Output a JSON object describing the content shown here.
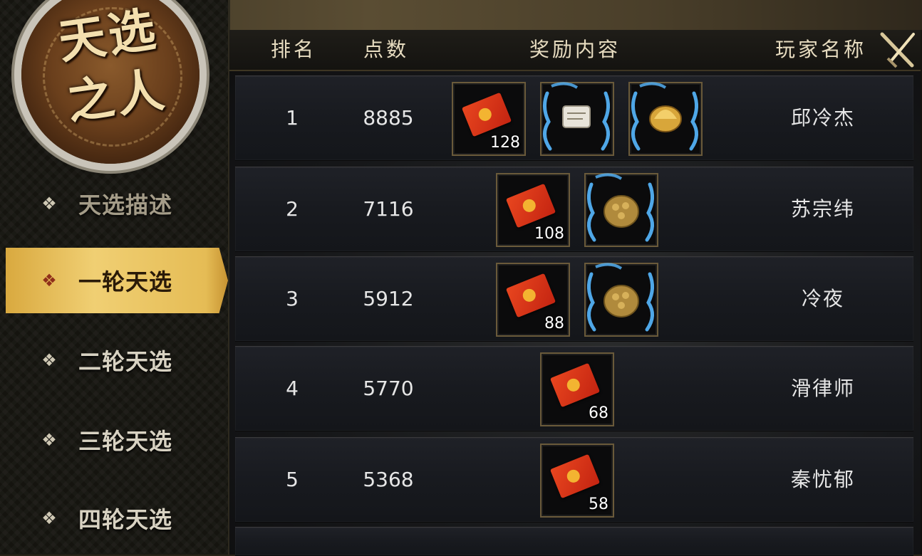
{
  "emblem": {
    "title_line1": "天选",
    "title_line2": "之人"
  },
  "menu": [
    {
      "label": "天选描述",
      "state": "dim"
    },
    {
      "label": "一轮天选",
      "state": "active"
    },
    {
      "label": "二轮天选",
      "state": "normal"
    },
    {
      "label": "三轮天选",
      "state": "normal"
    },
    {
      "label": "四轮天选",
      "state": "normal"
    }
  ],
  "table": {
    "headers": {
      "rank": "排名",
      "points": "点数",
      "rewards": "奖励内容",
      "player": "玩家名称"
    },
    "rows": [
      {
        "rank": "1",
        "points": "8885",
        "player": "邱冷杰",
        "rewards": [
          {
            "icon": "red-envelope-icon",
            "qty": "128"
          },
          {
            "icon": "scroll-icon",
            "qty": ""
          },
          {
            "icon": "golden-helmet-icon",
            "qty": ""
          }
        ]
      },
      {
        "rank": "2",
        "points": "7116",
        "player": "苏宗纬",
        "rewards": [
          {
            "icon": "red-envelope-icon",
            "qty": "108"
          },
          {
            "icon": "golden-egg-icon",
            "qty": ""
          }
        ]
      },
      {
        "rank": "3",
        "points": "5912",
        "player": "冷夜",
        "rewards": [
          {
            "icon": "red-envelope-icon",
            "qty": "88"
          },
          {
            "icon": "golden-egg-icon",
            "qty": ""
          }
        ]
      },
      {
        "rank": "4",
        "points": "5770",
        "player": "滑律师",
        "rewards": [
          {
            "icon": "red-envelope-icon",
            "qty": "68"
          }
        ]
      },
      {
        "rank": "5",
        "points": "5368",
        "player": "秦忧郁",
        "rewards": [
          {
            "icon": "red-envelope-icon",
            "qty": "58"
          }
        ]
      }
    ]
  },
  "colors": {
    "gold": "#f0cf73",
    "envelope_red": "#d8321a",
    "dragon_blue": "#57b8ff"
  }
}
